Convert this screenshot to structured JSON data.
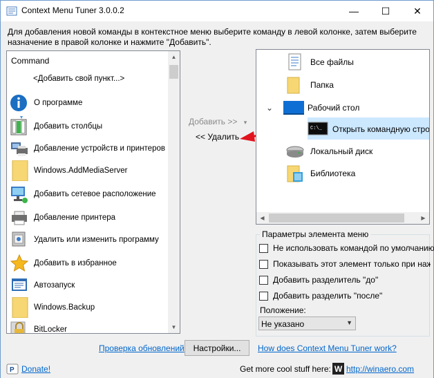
{
  "window": {
    "title": "Context Menu Tuner 3.0.0.2",
    "minimize": "—",
    "maximize": "☐",
    "close": "✕"
  },
  "description": "Для добавления новой команды в контекстное меню выберите команду в левой колонке, затем выберите назначение в правой колонке и нажмите \"Добавить\".",
  "command_list": {
    "header": "Command",
    "items": [
      {
        "label": "<Добавить свой пункт...>",
        "icon": "none"
      },
      {
        "label": "О программе",
        "icon": "info-icon"
      },
      {
        "label": "Добавить столбцы",
        "icon": "columns-icon"
      },
      {
        "label": "Добавление устройств и принтеров",
        "icon": "devices-printers-icon"
      },
      {
        "label": "Windows.AddMediaServer",
        "icon": "folder-icon"
      },
      {
        "label": "Добавить сетевое расположение",
        "icon": "network-location-icon"
      },
      {
        "label": "Добавление принтера",
        "icon": "printer-icon"
      },
      {
        "label": "Удалить или изменить программу",
        "icon": "programs-icon"
      },
      {
        "label": "Добавить в избранное",
        "icon": "star-icon"
      },
      {
        "label": "Автозапуск",
        "icon": "autoplay-icon"
      },
      {
        "label": "Windows.Backup",
        "icon": "folder-icon"
      },
      {
        "label": "BitLocker",
        "icon": "lock-icon"
      }
    ]
  },
  "actions": {
    "add_label": "Добавить >>",
    "add_arrow": "▾",
    "remove_label": "<< Удалить"
  },
  "tree": {
    "items": [
      {
        "label": "Все файлы",
        "icon": "file-icon"
      },
      {
        "label": "Папка",
        "icon": "folder-icon"
      },
      {
        "label": "Рабочий стол",
        "icon": "desktop-icon",
        "expander": "⌄"
      },
      {
        "label": "Открыть командную строку",
        "icon": "cmd-icon",
        "selected": true
      },
      {
        "label": "Локальный диск",
        "icon": "drive-icon"
      },
      {
        "label": "Библиотека",
        "icon": "library-icon"
      }
    ]
  },
  "params": {
    "legend": "Параметры элемента меню",
    "checkboxes": [
      {
        "label": "Не использовать командой по умолчанию",
        "checked": false
      },
      {
        "label": "Показывать этот элемент только при нажатом",
        "checked": false
      },
      {
        "label": "Добавить разделитель \"до\"",
        "checked": false
      },
      {
        "label": "Добавить разделить \"после\"",
        "checked": false
      }
    ],
    "position_label": "Положение:",
    "position_value": "Не указано"
  },
  "footer": {
    "check_updates": "Проверка обновлений",
    "settings_button": "Настройки...",
    "how_works": "How does Context Menu Tuner work?"
  },
  "statusbar": {
    "donate": "Donate!",
    "more_text": "Get more cool stuff here:",
    "winaero_logo": "W",
    "winaero_link": "http://winaero.com"
  },
  "colors": {
    "accent": "#0078d7",
    "link": "#0066cc",
    "selection": "#cce8ff",
    "arrow_red": "#e0141e"
  }
}
